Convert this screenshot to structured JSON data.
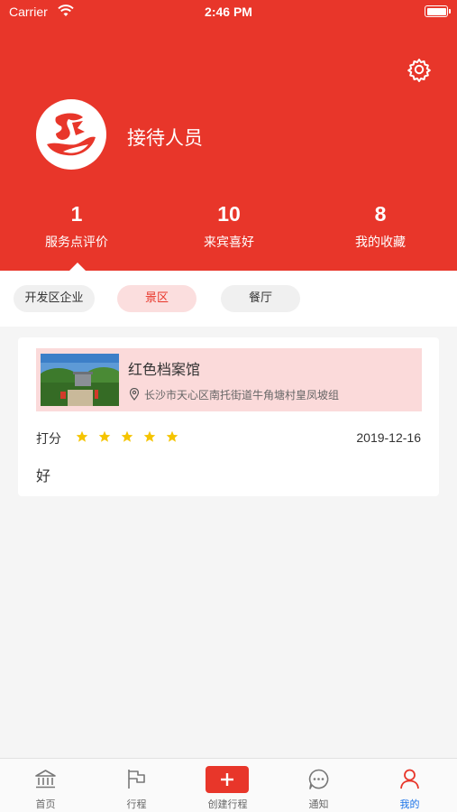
{
  "status_bar": {
    "carrier": "Carrier",
    "time": "2:46 PM"
  },
  "profile": {
    "name": "接待人员"
  },
  "stats": [
    {
      "value": "1",
      "label": "服务点评价"
    },
    {
      "value": "10",
      "label": "来宾喜好"
    },
    {
      "value": "8",
      "label": "我的收藏"
    }
  ],
  "filters": [
    "开发区企业",
    "景区",
    "餐厅"
  ],
  "review": {
    "place_name": "红色档案馆",
    "address": "长沙市天心区南托街道牛角塘村皇凤坡组",
    "score_label": "打分",
    "stars": 5,
    "date": "2019-12-16",
    "comment": "好"
  },
  "tabs": [
    {
      "label": "首页",
      "icon": "bank-icon"
    },
    {
      "label": "行程",
      "icon": "flag-icon"
    },
    {
      "label": "创建行程",
      "icon": "plus-icon"
    },
    {
      "label": "通知",
      "icon": "chat-icon"
    },
    {
      "label": "我的",
      "icon": "person-icon"
    }
  ],
  "colors": {
    "brand_red": "#e8362a",
    "active_tab": "#1a73e8",
    "star": "#f5c400"
  }
}
